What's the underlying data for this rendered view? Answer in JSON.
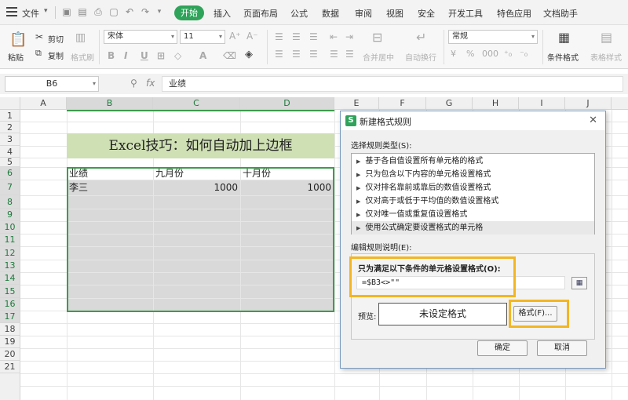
{
  "menubar": {
    "file": "文件",
    "tabs": [
      "开始",
      "插入",
      "页面布局",
      "公式",
      "数据",
      "审阅",
      "视图",
      "安全",
      "开发工具",
      "特色应用",
      "文档助手"
    ]
  },
  "ribbon": {
    "paste": "粘贴",
    "cut": "剪切",
    "copy": "复制",
    "format_painter": "格式刷",
    "font_name": "宋体",
    "font_size": "11",
    "merge_center": "合并居中",
    "wrap_text": "自动换行",
    "number_format": "常规",
    "conditional_format": "条件格式",
    "table_style": "表格样式"
  },
  "formula_bar": {
    "name_box": "B6",
    "fx_label": "fx",
    "content": "业绩"
  },
  "grid": {
    "columns": [
      "A",
      "B",
      "C",
      "D",
      "E",
      "F",
      "G",
      "H",
      "I",
      "J"
    ],
    "rows": [
      "1",
      "2",
      "3",
      "4",
      "5",
      "6",
      "7",
      "8",
      "9",
      "10",
      "11",
      "12",
      "13",
      "14",
      "15",
      "16",
      "17",
      "18",
      "19",
      "20",
      "21"
    ],
    "title": "Excel技巧：如何自动加上边框",
    "header_row": [
      "业绩",
      "九月份",
      "十月份"
    ],
    "data_row": [
      "李三",
      "1000",
      "1000"
    ]
  },
  "dialog": {
    "title": "新建格式规则",
    "select_rule_label": "选择规则类型(S):",
    "rule_types": [
      "基于各自值设置所有单元格的格式",
      "只为包含以下内容的单元格设置格式",
      "仅对排名靠前或靠后的数值设置格式",
      "仅对高于或低于平均值的数值设置格式",
      "仅对唯一值或重复值设置格式",
      "使用公式确定要设置格式的单元格"
    ],
    "edit_label": "编辑规则说明(E):",
    "condition_label": "只为满足以下条件的单元格设置格式(O):",
    "formula": "=$B3<>\"\"",
    "preview_label": "预览:",
    "preview_text": "未设定格式",
    "format_button": "格式(F)...",
    "ok": "确定",
    "cancel": "取消"
  }
}
